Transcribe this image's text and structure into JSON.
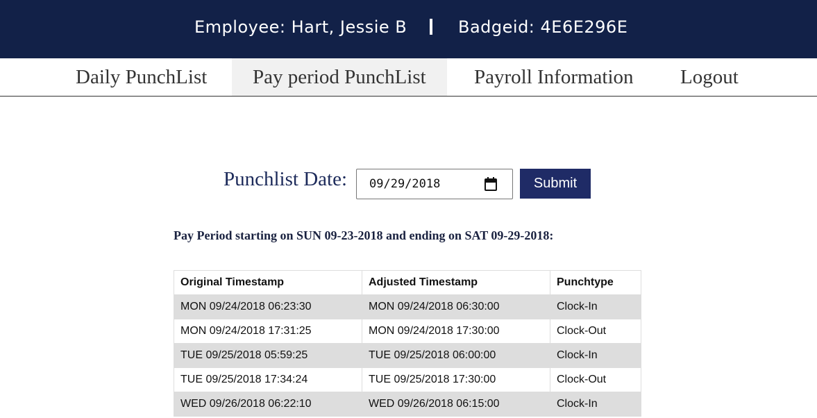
{
  "header": {
    "employee_text": "Employee: Hart, Jessie B",
    "badge_text": "Badgeid: 4E6E296E"
  },
  "nav": {
    "tabs": [
      {
        "label": "Daily PunchList",
        "active": false
      },
      {
        "label": "Pay period PunchList",
        "active": true
      },
      {
        "label": "Payroll Information",
        "active": false
      },
      {
        "label": "Logout",
        "active": false
      }
    ]
  },
  "form": {
    "label": "Punchlist Date:",
    "date_value": "09/29/2018",
    "submit_label": "Submit"
  },
  "period_text": "Pay Period starting on SUN 09-23-2018 and ending on SAT 09-29-2018:",
  "table": {
    "headers": [
      "Original Timestamp",
      "Adjusted Timestamp",
      "Punchtype"
    ],
    "rows": [
      [
        "MON 09/24/2018 06:23:30",
        "MON 09/24/2018 06:30:00",
        "Clock-In"
      ],
      [
        "MON 09/24/2018 17:31:25",
        "MON 09/24/2018 17:30:00",
        "Clock-Out"
      ],
      [
        "TUE 09/25/2018 05:59:25",
        "TUE 09/25/2018 06:00:00",
        "Clock-In"
      ],
      [
        "TUE 09/25/2018 17:34:24",
        "TUE 09/25/2018 17:30:00",
        "Clock-Out"
      ],
      [
        "WED 09/26/2018 06:22:10",
        "WED 09/26/2018 06:15:00",
        "Clock-In"
      ]
    ]
  },
  "colors": {
    "header_bg": "#122148",
    "button_bg": "#1f2b66",
    "row_shade": "#dddddd"
  }
}
